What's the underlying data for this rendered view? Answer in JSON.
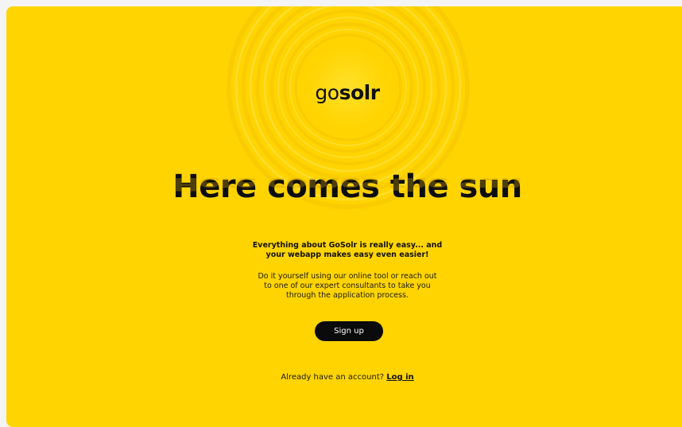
{
  "brand": {
    "logo_prefix": "go",
    "logo_suffix": "solr"
  },
  "hero": {
    "headline": "Here comes the sun",
    "tagline_line1": "Everything about GoSolr is really easy... and",
    "tagline_line2": "your webapp makes easy even easier!",
    "desc_line1": "Do it yourself using our online tool or reach out",
    "desc_line2": "to one of our expert consultants to take you",
    "desc_line3": "through the application process."
  },
  "actions": {
    "signup_label": "Sign up",
    "account_prompt": "Already have an account?",
    "login_label": "Log in"
  },
  "colors": {
    "background": "#ffd400",
    "button": "#0b0b0b",
    "text": "#111111"
  }
}
